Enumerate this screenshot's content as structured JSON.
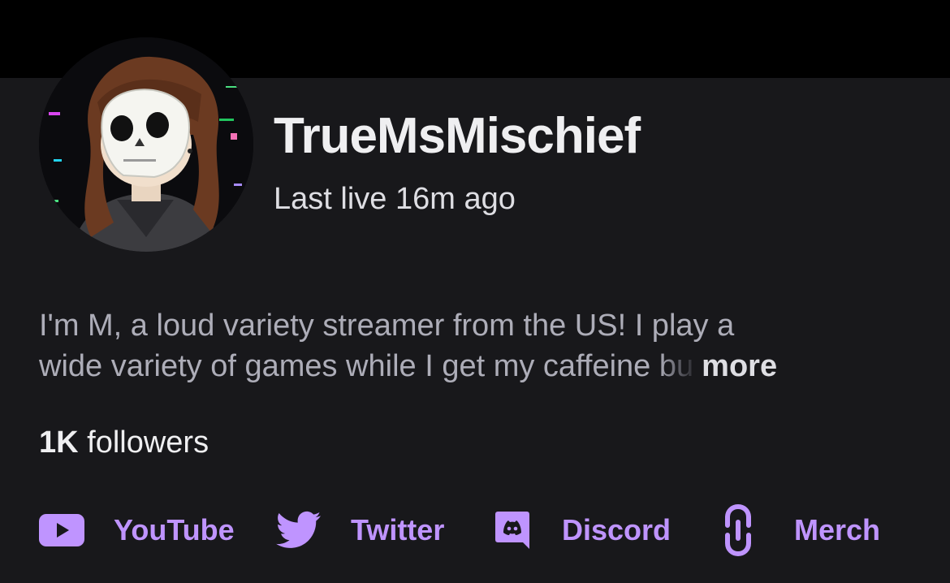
{
  "profile": {
    "name": "TrueMsMischief",
    "last_live": "Last live 16m ago"
  },
  "bio": {
    "line1": "I'm M, a loud variety streamer from the US! I play a",
    "line2_start": "wide variety of games while I get my caffeine ",
    "line2_fade": "bu",
    "more_label": "more"
  },
  "followers": {
    "count": "1K",
    "label": " followers"
  },
  "social_links": [
    {
      "icon": "youtube-icon",
      "label": "YouTube"
    },
    {
      "icon": "twitter-icon",
      "label": "Twitter"
    },
    {
      "icon": "discord-icon",
      "label": "Discord"
    },
    {
      "icon": "merch-link-icon",
      "label": "Merch"
    }
  ],
  "colors": {
    "background": "#18181b",
    "top_strip": "#000000",
    "accent": "#bf94ff",
    "text_primary": "#efeff1",
    "text_secondary": "#adadb8"
  }
}
